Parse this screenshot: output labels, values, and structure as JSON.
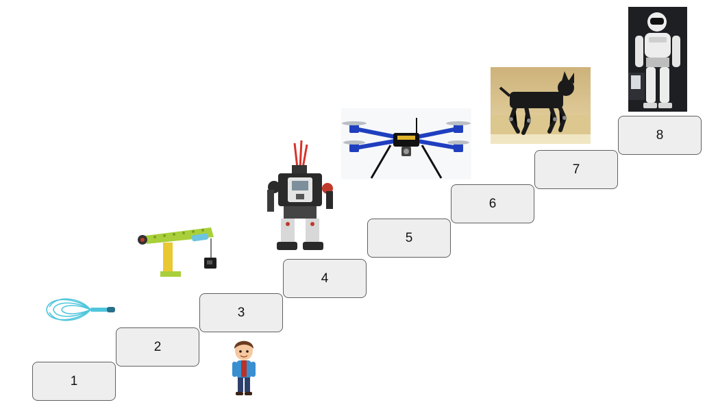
{
  "steps": [
    {
      "label": "1"
    },
    {
      "label": "2"
    },
    {
      "label": "3"
    },
    {
      "label": "4"
    },
    {
      "label": "5"
    },
    {
      "label": "6"
    },
    {
      "label": "7"
    },
    {
      "label": "8"
    }
  ],
  "illustrations": [
    {
      "icon": "whisk-icon"
    },
    {
      "icon": "lego-crane-icon"
    },
    {
      "icon": "child-icon"
    },
    {
      "icon": "lego-robot-icon"
    },
    {
      "icon": "quadcopter-drone-icon"
    },
    {
      "icon": "robot-dog-icon"
    },
    {
      "icon": "humanoid-robot-icon"
    }
  ],
  "colors": {
    "step_fill": "#eeeeee",
    "step_border": "#5f5f5f"
  }
}
